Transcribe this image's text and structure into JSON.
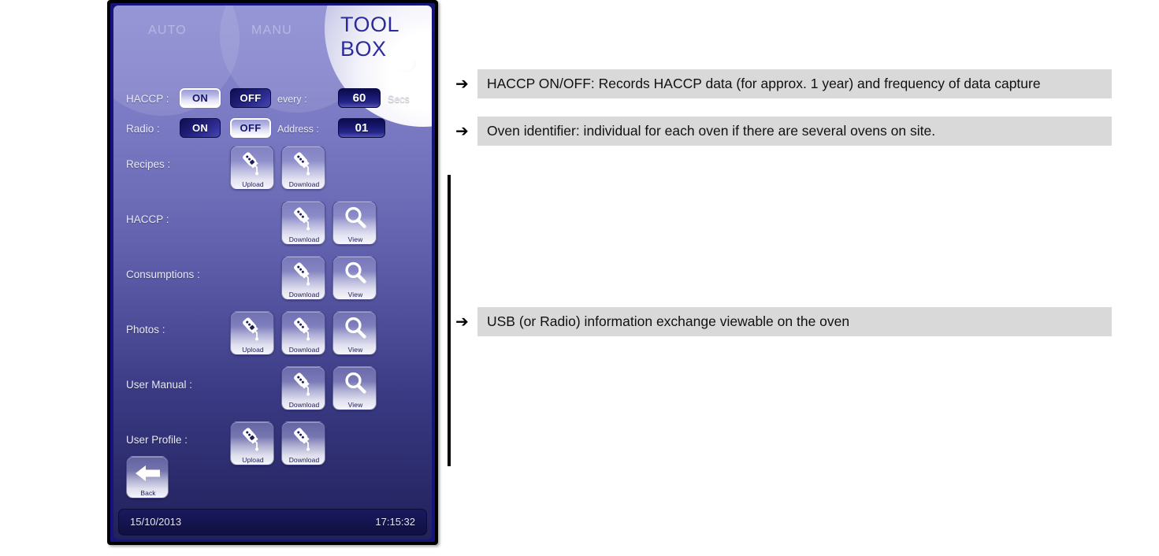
{
  "device": {
    "header": {
      "tabs": [
        {
          "id": "auto",
          "label": "AUTO"
        },
        {
          "id": "manu",
          "label": "MANU"
        }
      ],
      "title": "TOOL BOX"
    },
    "settings": {
      "haccp": {
        "label": "HACCP :",
        "on_label": "ON",
        "off_label": "OFF",
        "selected": "ON",
        "every_label": "every :",
        "interval_value": "60",
        "unit_label": "Secs"
      },
      "radio": {
        "label": "Radio :",
        "on_label": "ON",
        "off_label": "OFF",
        "selected": "OFF",
        "address_label": "Address :",
        "address_value": "01"
      }
    },
    "rows": [
      {
        "label": "Recipes :",
        "upload": "Upload",
        "download": "Download",
        "view": null
      },
      {
        "label": "HACCP :",
        "upload": null,
        "download": "Download",
        "view": "View"
      },
      {
        "label": "Consumptions :",
        "upload": null,
        "download": "Download",
        "view": "View"
      },
      {
        "label": "Photos :",
        "upload": "Upload",
        "download": "Download",
        "view": "View"
      },
      {
        "label": "User Manual :",
        "upload": null,
        "download": "Download",
        "view": "View"
      },
      {
        "label": "User Profile :",
        "upload": "Upload",
        "download": "Download",
        "view": null
      }
    ],
    "back_button": {
      "label": "Back"
    },
    "statusbar": {
      "date": "15/10/2013",
      "time": "17:15:32"
    }
  },
  "callouts": [
    {
      "arrow": "➔",
      "text": "HACCP ON/OFF: Records HACCP data (for approx. 1 year) and frequency of data capture"
    },
    {
      "arrow": "➔",
      "text": "Oven identifier: individual for each oven if there are several ovens on site."
    },
    {
      "arrow": "➔",
      "text": "USB (or Radio) information exchange viewable on the oven"
    }
  ],
  "colors": {
    "screen_top": "#8b8bd2",
    "screen_bottom": "#22215d",
    "title_blue": "#2b2b9c",
    "callout_bg": "#d9d9d9",
    "page_bg": "#ffffff"
  }
}
